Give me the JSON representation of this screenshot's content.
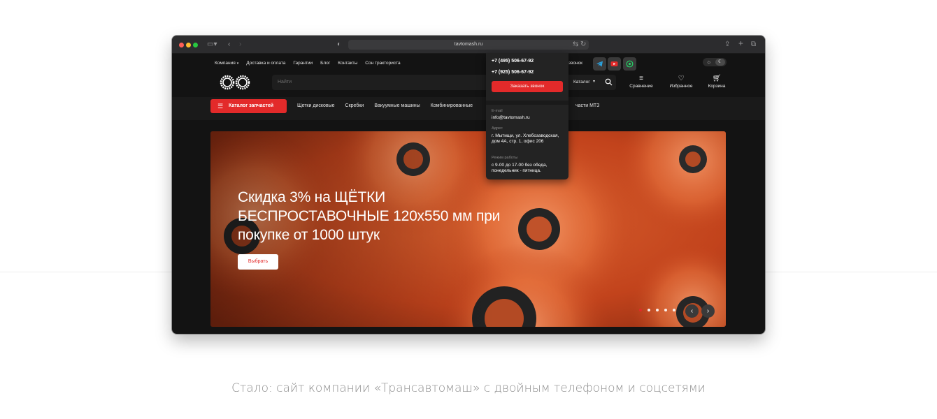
{
  "browser": {
    "url": "tavtomash.ru"
  },
  "site": {
    "top_nav": [
      "Компания",
      "Доставка и оплата",
      "Гарантии",
      "Блог",
      "Контакты",
      "Сон тракториста"
    ],
    "callback_link": "звонок",
    "search": {
      "placeholder": "Найти",
      "catalog_select": "Каталог"
    },
    "header_icons": {
      "compare": "Сравнение",
      "favorites": "Избранное",
      "cart": "Корзина"
    },
    "catalog_button": "Каталог запчастей",
    "categories": [
      "Щетки дисковые",
      "Скребки",
      "Вакуумные машины",
      "Комбинированные"
    ],
    "category_last": "части МТЗ",
    "social_colors": {
      "telegram": "#2aa3e0",
      "youtube": "#e32a2a",
      "whatsapp": "#25d366"
    },
    "accent_color": "#e32a2a"
  },
  "contacts_dropdown": {
    "phone1": "+7 (495) 506-67-92",
    "phone2": "+7 (925) 506-67-92",
    "call_button": "Заказать звонок",
    "email_label": "E-mail",
    "email": "info@tavtomash.ru",
    "address_label": "Адрес",
    "address": "г. Мытищи, ул. Хлебозаводская, дом 4А, стр. 1, офис 206",
    "hours_label": "Режим работы",
    "hours": "с 9-00 до 17-00 без обеда, понедельник - пятница."
  },
  "hero": {
    "title": "Скидка 3% на ЩЁТКИ БЕСПРОСТАВОЧНЫЕ 120х550 мм при покупке от 1000 штук",
    "button": "Выбрать",
    "slides_count": 5,
    "active_slide": 1
  },
  "caption": "Стало: сайт компании «Трансавтомаш» с двойным телефоном и соцсетями"
}
